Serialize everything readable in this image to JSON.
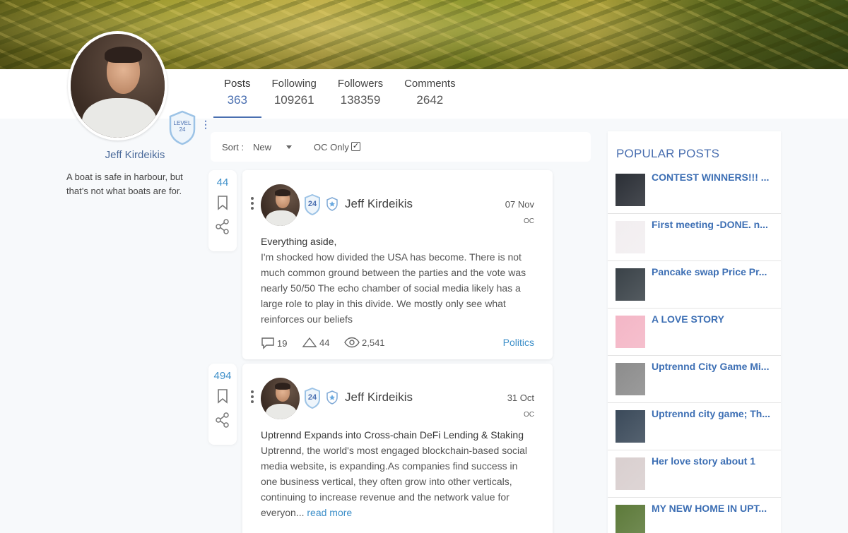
{
  "profile": {
    "name": "Jeff Kirdeikis",
    "bio": "A boat is safe in harbour, but that’s not what boats are for.",
    "level_label": "LEVEL",
    "level_value": "24"
  },
  "stats": [
    {
      "label": "Posts",
      "value": "363"
    },
    {
      "label": "Following",
      "value": "109261"
    },
    {
      "label": "Followers",
      "value": "138359"
    },
    {
      "label": "Comments",
      "value": "2642"
    }
  ],
  "sortbar": {
    "sort_label": "Sort :",
    "sort_value": "New",
    "oc_label": "OC Only",
    "oc_checked": "✓"
  },
  "posts": [
    {
      "votes": "44",
      "author": "Jeff Kirdeikis",
      "badge": "24",
      "date": "07 Nov",
      "tag": "OC",
      "first_line": "Everything aside,",
      "body": "I'm shocked how divided the USA has become. There is not much common ground between the parties and the vote was nearly 50/50 The echo chamber of social media likely has a large role to play in this divide. We mostly only see what reinforces our beliefs",
      "comments": "19",
      "upvotes": "44",
      "views": "2,541",
      "category": "Politics"
    },
    {
      "votes": "494",
      "author": "Jeff Kirdeikis",
      "badge": "24",
      "date": "31 Oct",
      "tag": "OC",
      "first_line": "Uptrennd Expands into Cross-chain DeFi Lending & Staking",
      "body": "Uptrennd, the world's most engaged blockchain-based social media website, is expanding.As companies find success in one business vertical, they often grow into other verticals, continuing to increase revenue and the network value for everyon...",
      "read_more": "read more"
    }
  ],
  "popular": {
    "title": "POPULAR POSTS",
    "items": [
      {
        "title": "CONTEST WINNERS!!! ...",
        "thumb": "#2b2f36"
      },
      {
        "title": "First meeting -DONE. n...",
        "thumb": "#f2eef0"
      },
      {
        "title": "Pancake swap Price Pr...",
        "thumb": "#3a4248"
      },
      {
        "title": "A LOVE STORY",
        "thumb": "#f4b6c6"
      },
      {
        "title": "Uptrennd City Game Mi...",
        "thumb": "#8c8c8c"
      },
      {
        "title": "Uptrennd city game; Th...",
        "thumb": "#3b4a5a"
      },
      {
        "title": "Her love story about 1",
        "thumb": "#d9cfcf"
      },
      {
        "title": "MY NEW HOME IN UPT...",
        "thumb": "#5d7a3a"
      }
    ]
  }
}
